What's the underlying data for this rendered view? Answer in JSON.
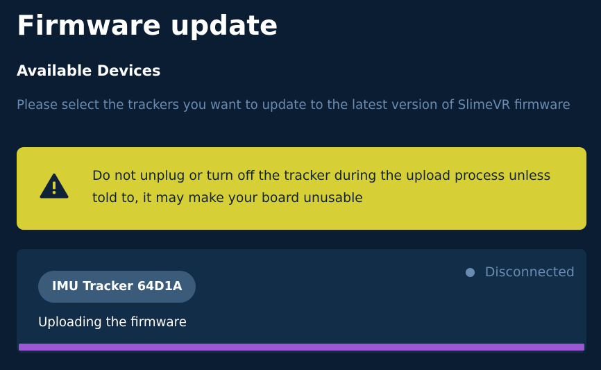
{
  "page": {
    "title": "Firmware update",
    "section_title": "Available Devices",
    "description": "Please select the trackers you want to update to the latest version of SlimeVR firmware"
  },
  "warning": {
    "icon": "warning-triangle-icon",
    "text": "Do not unplug or turn off the tracker during the upload process unless told to, it may make your board unusable",
    "background_color": "#d7cf36"
  },
  "device": {
    "name": "IMU Tracker 64D1A",
    "connection_status": "Disconnected",
    "status_dot_color": "#6a8cb2",
    "upload_status": "Uploading the firmware",
    "progress": 1.0,
    "progress_color": "#9b57d4"
  },
  "theme": {
    "background": "#0a1d33",
    "card_background": "#122d47",
    "muted_text": "#6a8cb2"
  }
}
